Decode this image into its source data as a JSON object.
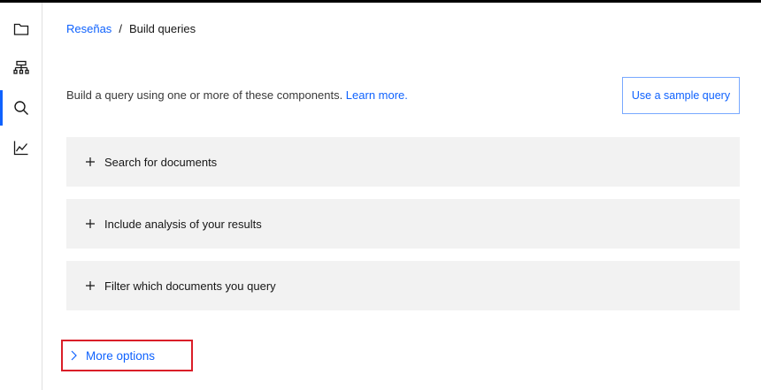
{
  "sidenav": {
    "items": [
      {
        "icon": "folder-icon",
        "active": false
      },
      {
        "icon": "hierarchy-icon",
        "active": false
      },
      {
        "icon": "search-icon",
        "active": true
      },
      {
        "icon": "chart-line-icon",
        "active": false
      }
    ]
  },
  "breadcrumb": {
    "parent": "Reseñas",
    "separator": "/",
    "current": "Build queries"
  },
  "intro": {
    "text": "Build a query using one or more of these components. ",
    "link": "Learn more."
  },
  "sample_button": "Use a sample query",
  "components": [
    {
      "label": "Search for documents"
    },
    {
      "label": "Include analysis of your results"
    },
    {
      "label": "Filter which documents you query"
    }
  ],
  "more_options": "More options",
  "colors": {
    "link": "#0f62fe",
    "tile_bg": "#f2f2f2",
    "highlight_border": "#da1e28",
    "nav_active": "#0f62fe"
  }
}
